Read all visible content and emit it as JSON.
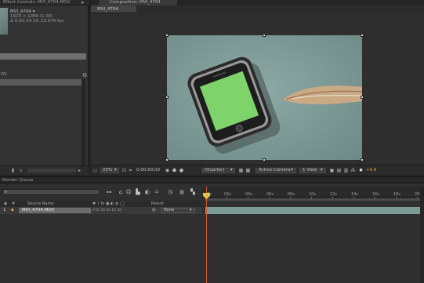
{
  "effect_controls": {
    "tab_title": "Effect Controls: MVI_4704.MOV",
    "clip_name": "MVI_4704 ▾",
    "resolution": "1920 × 1080 (1.00)",
    "duration": "Δ 0:00:29:19, 23.976 fps",
    "list_header": "OV"
  },
  "composition": {
    "tab_title": "Composition: MVI_4704",
    "subtab": "MVI_4704",
    "viewer": {
      "zoom": "25%",
      "timecode": "0;00;00;00",
      "resolution": "(Quarter)",
      "camera": "Active Camera",
      "views": "1 View",
      "exposure": "+0.0"
    }
  },
  "render_queue": {
    "title": "Render Queue",
    "search_placeholder": "",
    "columns": {
      "source_name": "Source Name",
      "parent": "Parent"
    },
    "layers": [
      {
        "index": "1",
        "name": "MVI_4704.MOV",
        "parent": "None"
      }
    ],
    "ruler_ticks": [
      "0s",
      "02s",
      "04s",
      "06s",
      "08s",
      "10s",
      "12s",
      "14s",
      "16s",
      "18s",
      "20s"
    ]
  },
  "colors": {
    "panel_bg": "#333333",
    "accent_cti": "#d05a28",
    "layer_bar": "#7a9b96",
    "screen_green": "#7ed36a"
  },
  "icons": [
    "lock-icon",
    "trash-icon",
    "search-icon",
    "snapshot-icon",
    "grid-icon",
    "fast-preview-icon",
    "chevron-down-icon"
  ]
}
